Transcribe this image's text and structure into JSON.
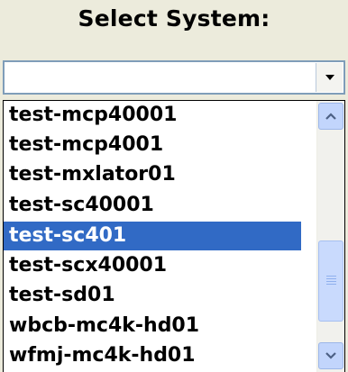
{
  "header": {
    "title": "Select System:"
  },
  "dropdown": {
    "selected_value": "",
    "arrow_icon": "chevron-down-icon"
  },
  "list": {
    "items": [
      {
        "label": "test-mcp40001",
        "selected": false
      },
      {
        "label": "test-mcp4001",
        "selected": false
      },
      {
        "label": "test-mxlator01",
        "selected": false
      },
      {
        "label": "test-sc40001",
        "selected": false
      },
      {
        "label": "test-sc401",
        "selected": true
      },
      {
        "label": "test-scx40001",
        "selected": false
      },
      {
        "label": "test-sd01",
        "selected": false
      },
      {
        "label": "wbcb-mc4k-hd01",
        "selected": false
      },
      {
        "label": "wfmj-mc4k-hd01",
        "selected": false
      }
    ],
    "scroll_position": 0.8
  },
  "colors": {
    "background": "#ecebdc",
    "selection": "#316ac5",
    "selection_text": "#ffffff",
    "scrollbar_button": "#c2d5fc"
  }
}
